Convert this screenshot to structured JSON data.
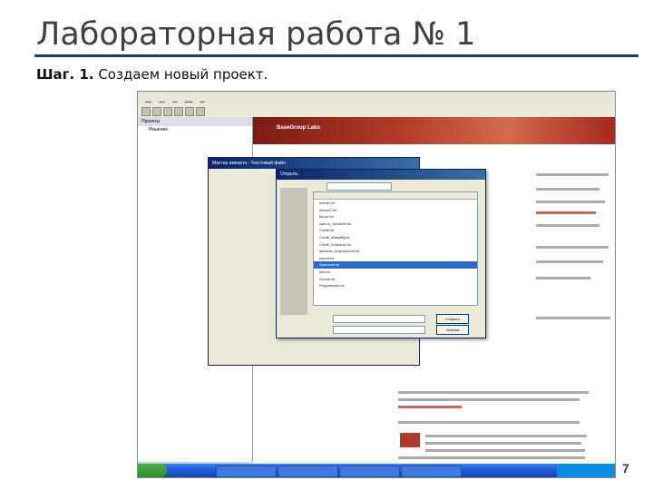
{
  "slide": {
    "title": "Лабораторная работа № 1",
    "step_label": "Шаг. 1.",
    "step_text": "Создаем новый проект.",
    "page_number": "7"
  },
  "screenshot": {
    "left_panel_title": "Проекты",
    "tree_item": "Решение",
    "brand_name": "BaseGroup Labs",
    "open_dialog_title": "Открыть",
    "open_button": "Открыть",
    "cancel_button": "Отмена",
    "back_dialog_title": "Мастер импорта - Текстовый файл",
    "file_rows": [
      "before.txt",
      "before2.txt",
      "Bs-ac.txt",
      "cats-ru_bymonth.txt",
      "Credit.txt",
      "Credit_reliability.txt",
      "Credit_Schedule.txt",
      "dynamic_employment.txt",
      "export.txt",
      "Sparrows.txt",
      "fact.txt",
      "Goods.txt",
      "Pregnancies.txt"
    ],
    "selected_row": 9
  }
}
